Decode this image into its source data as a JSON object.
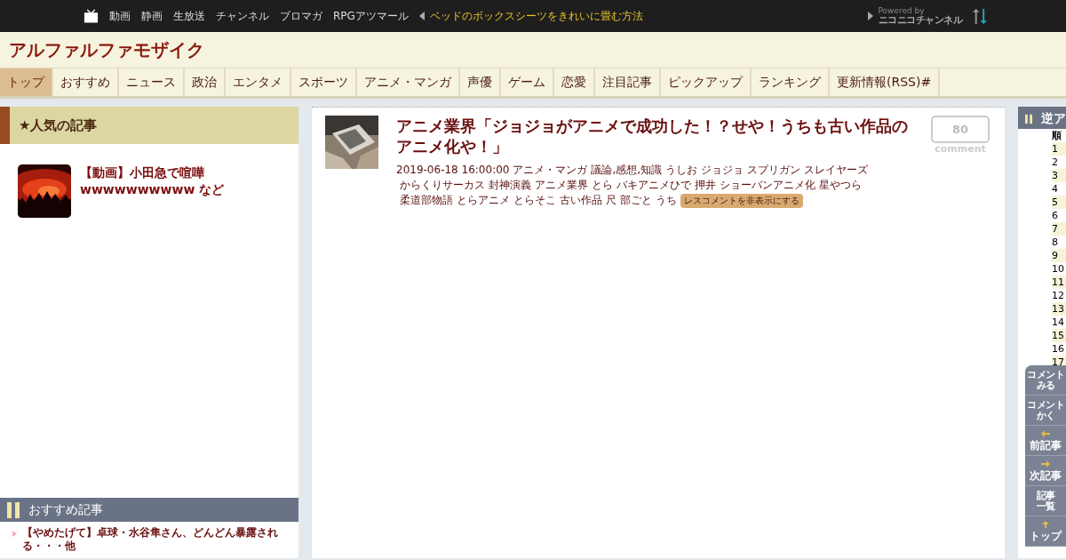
{
  "topbar": {
    "links": [
      "動画",
      "静画",
      "生放送",
      "チャンネル",
      "ブロマガ",
      "RPGアツマール"
    ],
    "headline": "ベッドのボックスシーツをきれいに畳む方法",
    "powered_by": "Powered by",
    "brand": "ニコニコチャンネル"
  },
  "site": {
    "title": "アルファルファモザイク"
  },
  "tabs": [
    {
      "label": "トップ",
      "selected": true
    },
    {
      "label": "おすすめ",
      "selected": false
    },
    {
      "label": "ニュース",
      "selected": false
    },
    {
      "label": "政治",
      "selected": false
    },
    {
      "label": "エンタメ",
      "selected": false
    },
    {
      "label": "スポーツ",
      "selected": false
    },
    {
      "label": "アニメ・マンガ",
      "selected": false
    },
    {
      "label": "声優",
      "selected": false
    },
    {
      "label": "ゲーム",
      "selected": false
    },
    {
      "label": "恋愛",
      "selected": false
    },
    {
      "label": "注目記事",
      "selected": false
    },
    {
      "label": "ピックアップ",
      "selected": false
    },
    {
      "label": "ランキング",
      "selected": false
    },
    {
      "label": "更新情報(RSS)#",
      "selected": false
    }
  ],
  "popular": {
    "title": "★人気の記事",
    "items": [
      {
        "title": "【動画】小田急で喧嘩wwwwwwwwww など"
      }
    ]
  },
  "recommended": {
    "title": "おすすめ記事",
    "items": [
      "【やめたげて】卓球・水谷隼さん、どんどん暴露される・・・他"
    ]
  },
  "article": {
    "title": "アニメ業界「ジョジョがアニメで成功した！？せや！うちも古い作品のアニメ化や！」",
    "date": "2019-06-18 16:00:00",
    "tags": [
      "アニメ・マンガ",
      "議論,感想,知識",
      "うしお",
      "ジョジョ",
      "スプリガン",
      "スレイヤーズ",
      "からくりサーカス",
      "封神演義",
      "アニメ業界",
      "とら",
      "バキアニメひで",
      "押井",
      "ショーバンアニメ化",
      "星やつら",
      "柔道部物語",
      "とらアニメ",
      "とらそこ",
      "古い作品",
      "尺",
      "部ごと",
      "うち"
    ],
    "hide_button": "レスコメントを非表示にする",
    "comment_count": "80",
    "comment_label": "comment"
  },
  "ranking": {
    "title": "逆ア",
    "header": "順",
    "ranks": [
      "1",
      "2",
      "3",
      "4",
      "5",
      "6",
      "7",
      "8",
      "9",
      "10",
      "11",
      "12",
      "13",
      "14",
      "15",
      "16",
      "17"
    ]
  },
  "side_buttons": [
    {
      "kind": "text",
      "lines": [
        "コメント",
        "みる"
      ]
    },
    {
      "kind": "text",
      "lines": [
        "コメント",
        "かく"
      ]
    },
    {
      "kind": "left",
      "lines": [
        "前記事"
      ]
    },
    {
      "kind": "right",
      "lines": [
        "次記事"
      ]
    },
    {
      "kind": "text",
      "lines": [
        "記事",
        "一覧"
      ]
    },
    {
      "kind": "up",
      "lines": [
        "トップ"
      ]
    }
  ]
}
